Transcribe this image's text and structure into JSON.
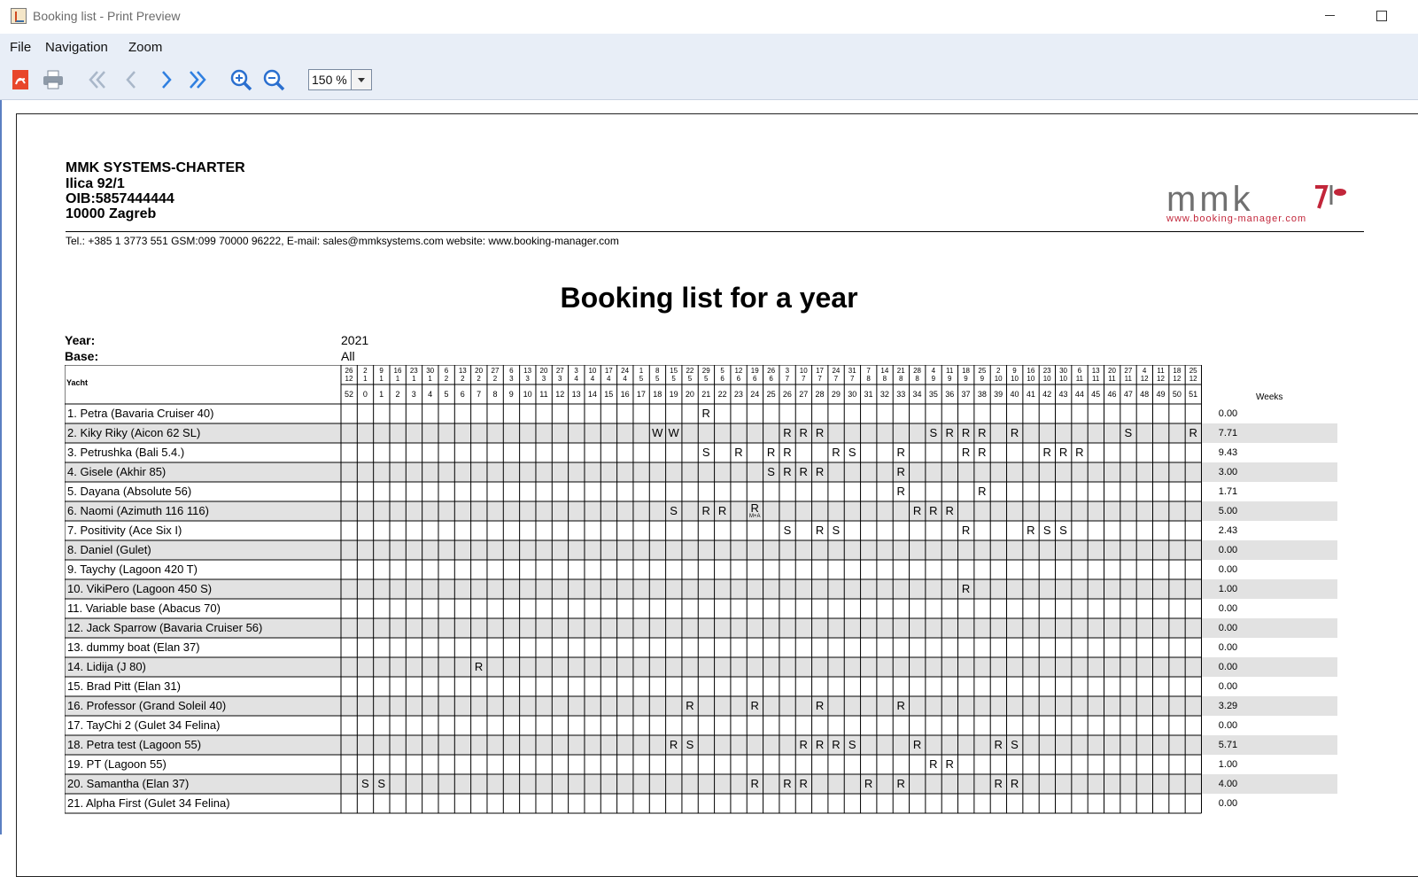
{
  "window": {
    "title": "Booking list - Print Preview"
  },
  "menu": [
    "File",
    "Navigation",
    "Zoom"
  ],
  "toolbar": {
    "zoom": "150 %"
  },
  "header": {
    "company": [
      "MMK SYSTEMS-CHARTER",
      "Ilica 92/1",
      "OIB:5857444444",
      "10000 Zagreb"
    ],
    "contact": "Tel.: +385 1 3773 551 GSM:099 70000 96222, E-mail: sales@mmksystems.com website: www.booking-manager.com",
    "logo_text": "mmk",
    "logo_url": "www.booking-manager.com"
  },
  "report": {
    "title": "Booking list for a year",
    "year_label": "Year:",
    "year": "2021",
    "base_label": "Base:",
    "base": "All",
    "yacht_header": "Yacht",
    "weeks_header": "Weeks"
  },
  "dates": [
    [
      "26",
      "12"
    ],
    [
      "2",
      "1"
    ],
    [
      "9",
      "1"
    ],
    [
      "16",
      "1"
    ],
    [
      "23",
      "1"
    ],
    [
      "30",
      "1"
    ],
    [
      "6",
      "2"
    ],
    [
      "13",
      "2"
    ],
    [
      "20",
      "2"
    ],
    [
      "27",
      "2"
    ],
    [
      "6",
      "3"
    ],
    [
      "13",
      "3"
    ],
    [
      "20",
      "3"
    ],
    [
      "27",
      "3"
    ],
    [
      "3",
      "4"
    ],
    [
      "10",
      "4"
    ],
    [
      "17",
      "4"
    ],
    [
      "24",
      "4"
    ],
    [
      "1",
      "5"
    ],
    [
      "8",
      "5"
    ],
    [
      "15",
      "5"
    ],
    [
      "22",
      "5"
    ],
    [
      "29",
      "5"
    ],
    [
      "5",
      "6"
    ],
    [
      "12",
      "6"
    ],
    [
      "19",
      "6"
    ],
    [
      "26",
      "6"
    ],
    [
      "3",
      "7"
    ],
    [
      "10",
      "7"
    ],
    [
      "17",
      "7"
    ],
    [
      "24",
      "7"
    ],
    [
      "31",
      "7"
    ],
    [
      "7",
      "8"
    ],
    [
      "14",
      "8"
    ],
    [
      "21",
      "8"
    ],
    [
      "28",
      "8"
    ],
    [
      "4",
      "9"
    ],
    [
      "11",
      "9"
    ],
    [
      "18",
      "9"
    ],
    [
      "25",
      "9"
    ],
    [
      "2",
      "10"
    ],
    [
      "9",
      "10"
    ],
    [
      "16",
      "10"
    ],
    [
      "23",
      "10"
    ],
    [
      "30",
      "10"
    ],
    [
      "6",
      "11"
    ],
    [
      "13",
      "11"
    ],
    [
      "20",
      "11"
    ],
    [
      "27",
      "11"
    ],
    [
      "4",
      "12"
    ],
    [
      "11",
      "12"
    ],
    [
      "18",
      "12"
    ],
    [
      "25",
      "12"
    ]
  ],
  "weeks": [
    "52",
    "0",
    "1",
    "2",
    "3",
    "4",
    "5",
    "6",
    "7",
    "8",
    "9",
    "10",
    "11",
    "12",
    "13",
    "14",
    "15",
    "16",
    "17",
    "18",
    "19",
    "20",
    "21",
    "22",
    "23",
    "24",
    "25",
    "26",
    "27",
    "28",
    "29",
    "30",
    "31",
    "32",
    "33",
    "34",
    "35",
    "36",
    "37",
    "38",
    "39",
    "40",
    "41",
    "42",
    "43",
    "44",
    "45",
    "46",
    "47",
    "48",
    "49",
    "50",
    "51"
  ],
  "yachts": [
    {
      "name": "1. Petra (Bavaria Cruiser 40)",
      "weeks": "0.00",
      "marks": [
        [
          22,
          "R"
        ]
      ]
    },
    {
      "name": "2. Kiky Riky (Aicon 62 SL)",
      "weeks": "7.71",
      "marks": [
        [
          19,
          "W"
        ],
        [
          20,
          "W"
        ],
        [
          27,
          "R"
        ],
        [
          28,
          "R"
        ],
        [
          29,
          "R"
        ],
        [
          36,
          "S"
        ],
        [
          37,
          "R"
        ],
        [
          38,
          "R"
        ],
        [
          39,
          "R"
        ],
        [
          41,
          "R"
        ],
        [
          48,
          "S"
        ],
        [
          52,
          "R"
        ]
      ]
    },
    {
      "name": "3. Petrushka (Bali 5.4.)",
      "weeks": "9.43",
      "marks": [
        [
          22,
          "S"
        ],
        [
          24,
          "R"
        ],
        [
          26,
          "R"
        ],
        [
          27,
          "R"
        ],
        [
          30,
          "R"
        ],
        [
          31,
          "S"
        ],
        [
          34,
          "R"
        ],
        [
          38,
          "R"
        ],
        [
          39,
          "R"
        ],
        [
          43,
          "R"
        ],
        [
          44,
          "R"
        ],
        [
          45,
          "R"
        ]
      ]
    },
    {
      "name": "4. Gisele (Akhir 85)",
      "weeks": "3.00",
      "marks": [
        [
          26,
          "S"
        ],
        [
          27,
          "R"
        ],
        [
          28,
          "R"
        ],
        [
          29,
          "R"
        ],
        [
          34,
          "R"
        ]
      ]
    },
    {
      "name": "5. Dayana (Absolute 56)",
      "weeks": "1.71",
      "marks": [
        [
          34,
          "R"
        ],
        [
          39,
          "R"
        ]
      ]
    },
    {
      "name": "6. Naomi (Azimuth 116 116)",
      "weeks": "5.00",
      "marks": [
        [
          20,
          "S"
        ],
        [
          22,
          "R"
        ],
        [
          23,
          "R"
        ],
        [
          25,
          "R",
          "M+A"
        ],
        [
          35,
          "R"
        ],
        [
          36,
          "R"
        ],
        [
          37,
          "R"
        ]
      ]
    },
    {
      "name": "7. Positivity (Ace Six I)",
      "weeks": "2.43",
      "marks": [
        [
          27,
          "S"
        ],
        [
          29,
          "R"
        ],
        [
          30,
          "S"
        ],
        [
          38,
          "R"
        ],
        [
          42,
          "R"
        ],
        [
          43,
          "S"
        ],
        [
          44,
          "S"
        ]
      ]
    },
    {
      "name": "8. Daniel  (Gulet)",
      "weeks": "0.00",
      "marks": []
    },
    {
      "name": "9. Taychy (Lagoon 420 T)",
      "weeks": "0.00",
      "marks": []
    },
    {
      "name": "10. VikiPero (Lagoon 450 S)",
      "weeks": "1.00",
      "marks": [
        [
          38,
          "R"
        ]
      ]
    },
    {
      "name": "11. Variable base (Abacus 70)",
      "weeks": "0.00",
      "marks": []
    },
    {
      "name": "12. Jack Sparrow (Bavaria Cruiser 56)",
      "weeks": "0.00",
      "marks": []
    },
    {
      "name": "13. dummy boat (Elan 37)",
      "weeks": "0.00",
      "marks": []
    },
    {
      "name": "14. Lidija (J 80)",
      "weeks": "0.00",
      "marks": [
        [
          8,
          "R"
        ]
      ]
    },
    {
      "name": "15. Brad Pitt (Elan 31)",
      "weeks": "0.00",
      "marks": []
    },
    {
      "name": "16. Professor (Grand Soleil 40)",
      "weeks": "3.29",
      "marks": [
        [
          21,
          "R"
        ],
        [
          25,
          "R"
        ],
        [
          29,
          "R"
        ],
        [
          34,
          "R"
        ]
      ]
    },
    {
      "name": "17. TayChi 2 (Gulet 34 Felina)",
      "weeks": "0.00",
      "marks": []
    },
    {
      "name": "18. Petra test (Lagoon 55)",
      "weeks": "5.71",
      "marks": [
        [
          20,
          "R"
        ],
        [
          21,
          "S"
        ],
        [
          28,
          "R"
        ],
        [
          29,
          "R"
        ],
        [
          30,
          "R"
        ],
        [
          31,
          "S"
        ],
        [
          35,
          "R"
        ],
        [
          40,
          "R"
        ],
        [
          41,
          "S"
        ]
      ]
    },
    {
      "name": "19. PT (Lagoon 55)",
      "weeks": "1.00",
      "marks": [
        [
          36,
          "R"
        ],
        [
          37,
          "R"
        ]
      ]
    },
    {
      "name": "20. Samantha (Elan 37)",
      "weeks": "4.00",
      "marks": [
        [
          1,
          "S"
        ],
        [
          2,
          "S"
        ],
        [
          25,
          "R"
        ],
        [
          27,
          "R"
        ],
        [
          28,
          "R"
        ],
        [
          32,
          "R"
        ],
        [
          34,
          "R"
        ],
        [
          40,
          "R"
        ],
        [
          41,
          "R"
        ]
      ]
    },
    {
      "name": "21. Alpha First (Gulet 34 Felina)",
      "weeks": "0.00",
      "marks": []
    }
  ]
}
